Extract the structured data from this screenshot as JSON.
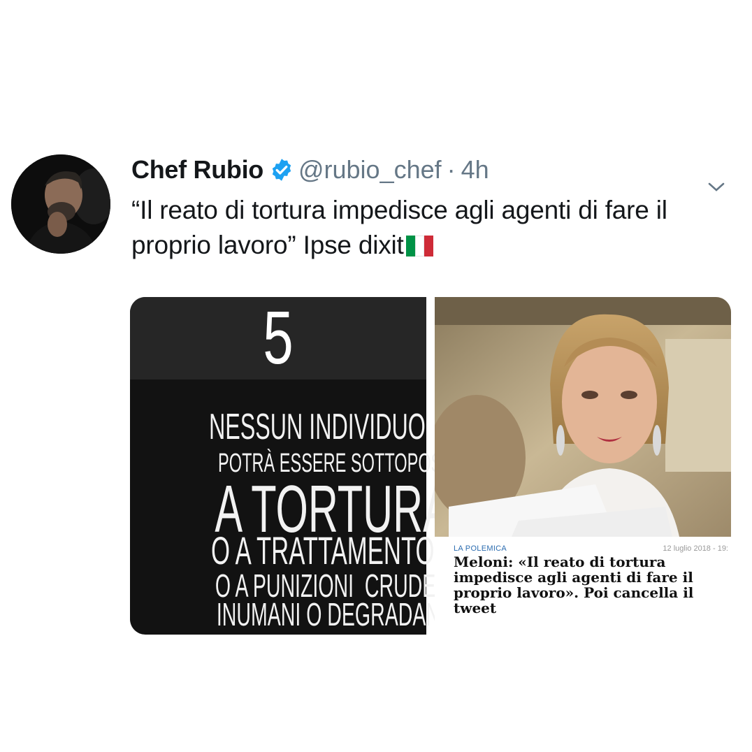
{
  "tweet": {
    "display_name": "Chef Rubio",
    "handle": "@rubio_chef",
    "separator": "·",
    "time": "4h",
    "text": "“Il reato di tortura impedisce agli agenti di fare il proprio lavoro” Ipse dixit",
    "flag_colors": [
      "#009246",
      "#ffffff",
      "#ce2b37"
    ],
    "verified_color": "#1da1f2"
  },
  "media": {
    "left_panel": {
      "number": "5",
      "lines": [
        "NESSUN INDIVIDUO",
        "POTRÀ ESSERE SOTTOPOSTO",
        "A TORTURA",
        "O A TRATTAMENTO",
        "O A PUNIZIONI  CRUDELI",
        "INUMANI O DEGRADANTI"
      ]
    },
    "right_panel": {
      "kicker": "LA POLEMICA",
      "date": "12 luglio 2018 - 19:",
      "headline": "Meloni: «Il reato di tortura impedisce agli agenti di fare il proprio lavoro». Poi cancella il tweet"
    }
  }
}
